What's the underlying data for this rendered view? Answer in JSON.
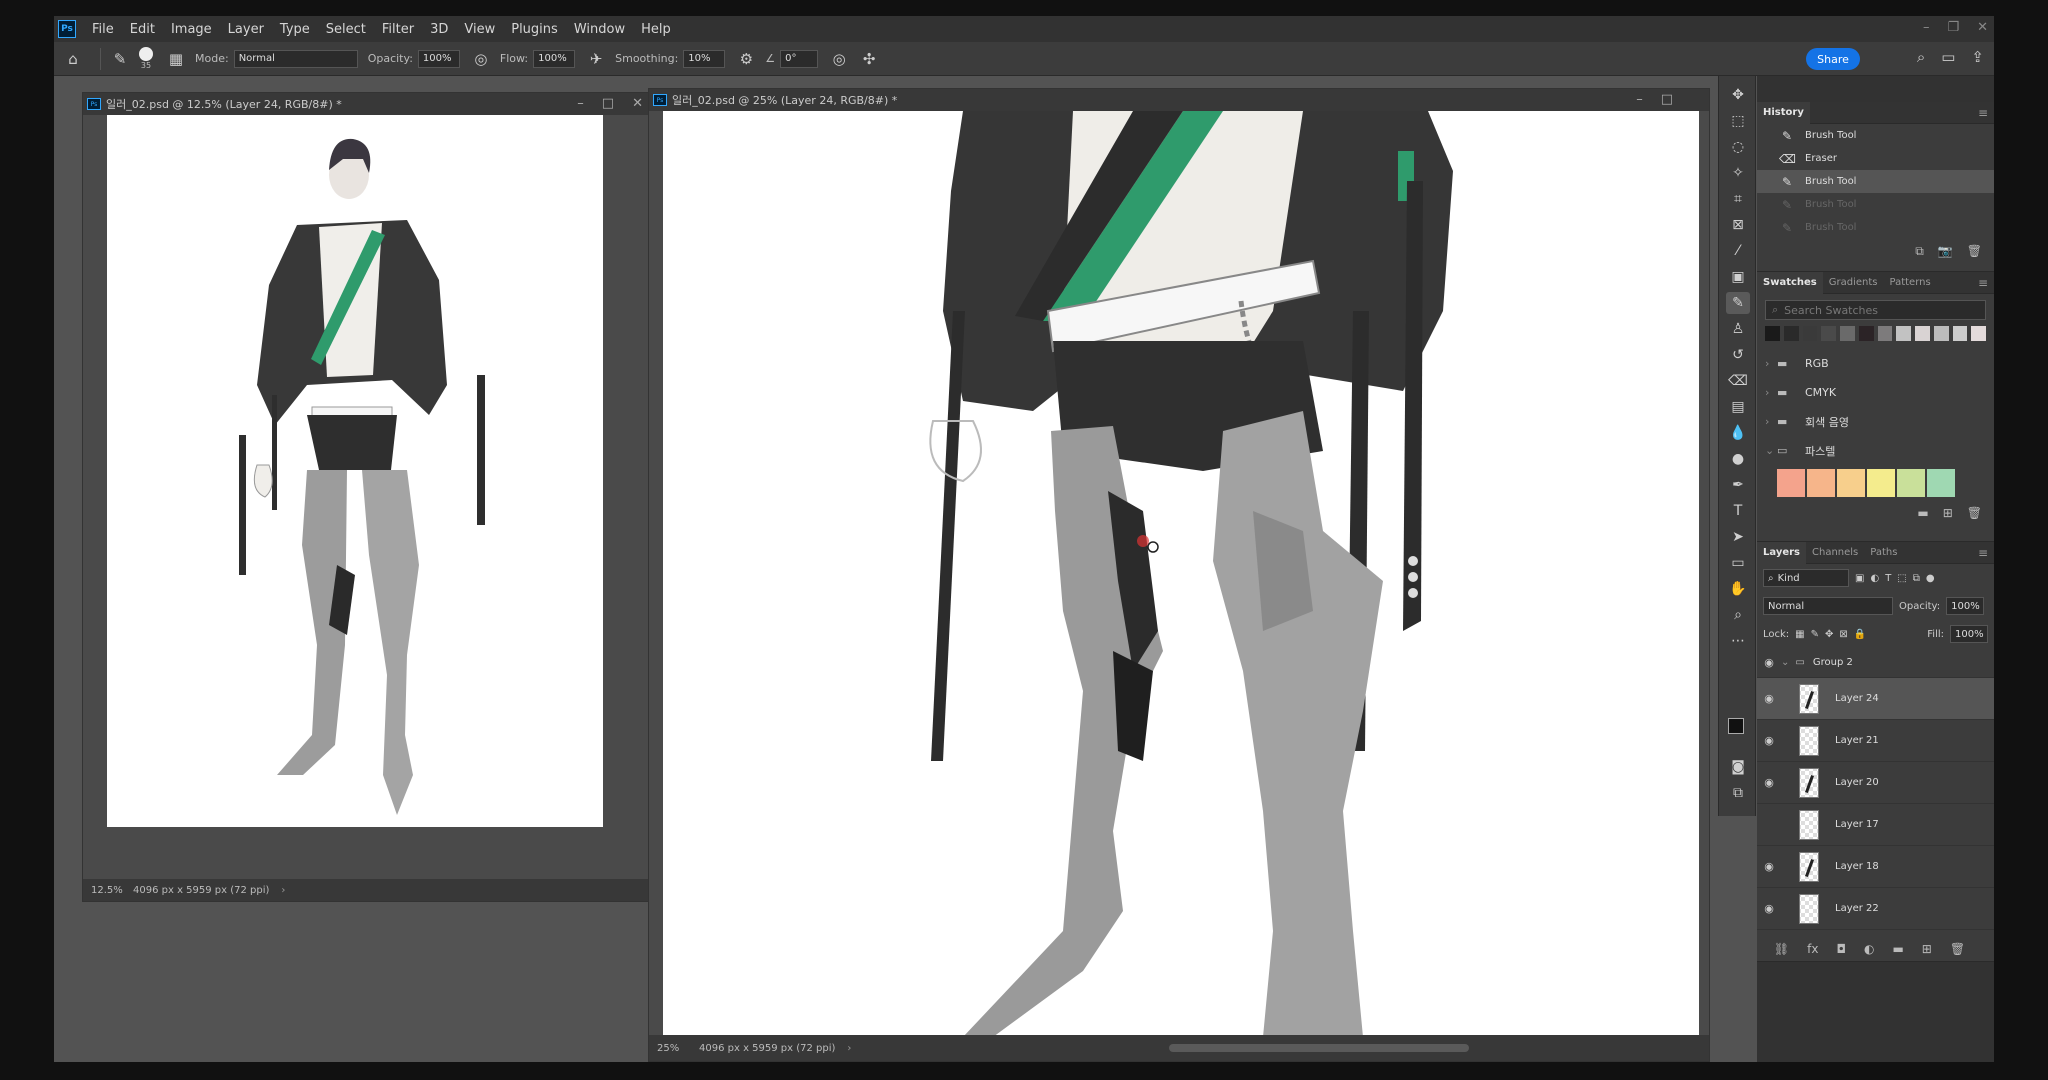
{
  "menu": {
    "items": [
      "File",
      "Edit",
      "Image",
      "Layer",
      "Type",
      "Select",
      "Filter",
      "3D",
      "View",
      "Plugins",
      "Window",
      "Help"
    ]
  },
  "options": {
    "brush_size": "35",
    "mode_label": "Mode:",
    "mode_value": "Normal",
    "opacity_label": "Opacity:",
    "opacity_value": "100%",
    "flow_label": "Flow:",
    "flow_value": "100%",
    "smoothing_label": "Smoothing:",
    "smoothing_value": "10%",
    "angle_value": "0°",
    "share_label": "Share"
  },
  "doc_left": {
    "title": "일러_02.psd @ 12.5% (Layer 24, RGB/8#) *",
    "zoom": "12.5%",
    "info": "4096 px x 5959 px (72 ppi)"
  },
  "doc_main": {
    "title": "일러_02.psd @ 25% (Layer 24, RGB/8#) *",
    "zoom": "25%",
    "info": "4096 px x 5959 px (72 ppi)"
  },
  "history": {
    "tab": "History",
    "items": [
      {
        "label": "Brush Tool",
        "icon": "brush-icon",
        "state": "normal"
      },
      {
        "label": "Eraser",
        "icon": "eraser-icon",
        "state": "normal"
      },
      {
        "label": "Brush Tool",
        "icon": "brush-icon",
        "state": "selected"
      },
      {
        "label": "Brush Tool",
        "icon": "brush-icon",
        "state": "dim"
      },
      {
        "label": "Brush Tool",
        "icon": "brush-icon",
        "state": "dim"
      }
    ]
  },
  "swatches": {
    "tabs": [
      "Swatches",
      "Gradients",
      "Patterns"
    ],
    "search_placeholder": "Search Swatches",
    "recent": [
      "#1a1a1a",
      "#2a2a2a",
      "#3a3a3a",
      "#4a4a4a",
      "#6a6a6a",
      "#2b2326",
      "#7d7b7c",
      "#c2c2c2",
      "#d9d3d3",
      "#bcbcbc",
      "#cdcdcd",
      "#e3dada"
    ],
    "folders": [
      "RGB",
      "CMYK",
      "회색 음영",
      "파스텔"
    ],
    "pastel": [
      "#f4a38c",
      "#f6b58a",
      "#f7cf8c",
      "#f4ec8d",
      "#c9e09a",
      "#9fd8b2"
    ]
  },
  "layers": {
    "tabs": [
      "Layers",
      "Channels",
      "Paths"
    ],
    "filter_value": "Kind",
    "blend_value": "Normal",
    "opacity_label": "Opacity:",
    "opacity_value": "100%",
    "lock_label": "Lock:",
    "fill_label": "Fill:",
    "fill_value": "100%",
    "group_name": "Group 2",
    "items": [
      {
        "name": "Layer 24",
        "visible": true,
        "selected": true
      },
      {
        "name": "Layer 21",
        "visible": true,
        "selected": false
      },
      {
        "name": "Layer 20",
        "visible": true,
        "selected": false
      },
      {
        "name": "Layer 17",
        "visible": false,
        "selected": false
      },
      {
        "name": "Layer 18",
        "visible": true,
        "selected": false
      },
      {
        "name": "Layer 22",
        "visible": true,
        "selected": false
      }
    ]
  },
  "colors": {
    "jacket": "#3a3a3a",
    "armor": "#9c9c9c",
    "accent_green": "#2f9b6c",
    "shirt": "#f0eeea"
  }
}
